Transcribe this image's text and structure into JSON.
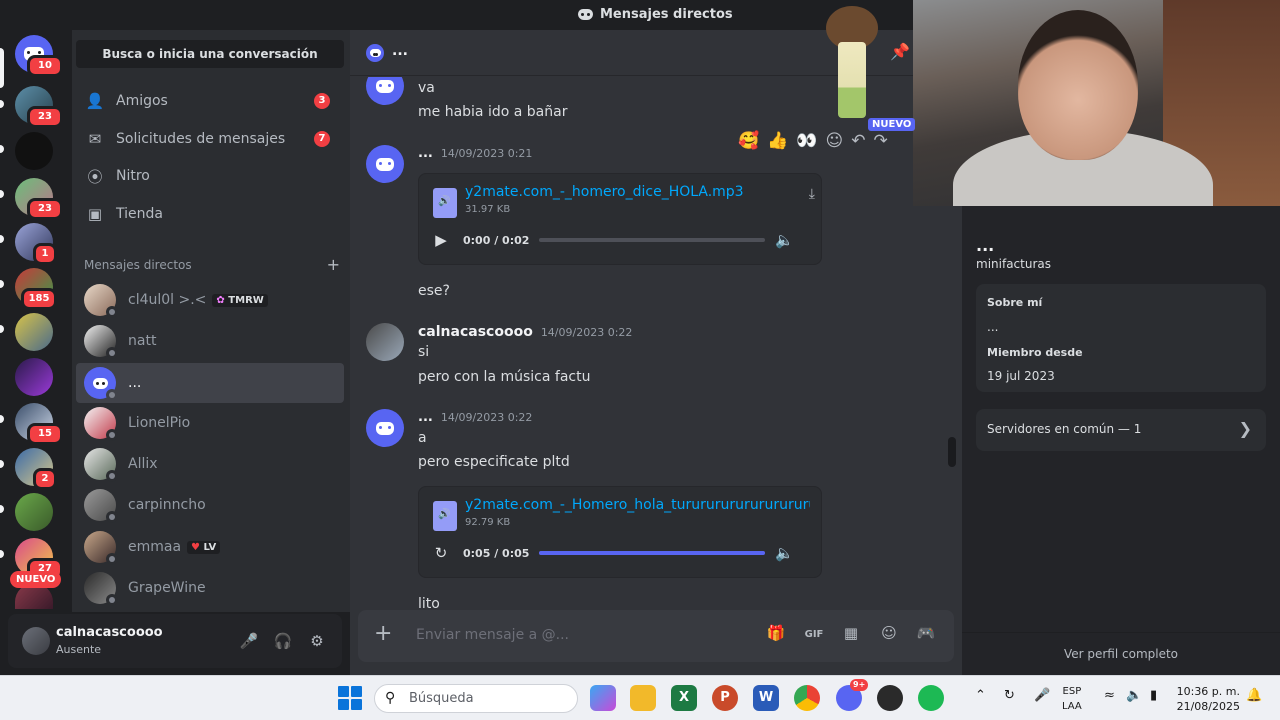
{
  "window": {
    "title": "Mensajes directos"
  },
  "rail": {
    "badges": [
      "10",
      "23",
      "23",
      "1",
      "185",
      "15",
      "2",
      "27"
    ],
    "new_label": "NUEVO"
  },
  "sidebar": {
    "search_placeholder": "Busca o inicia una conversación",
    "nav": [
      {
        "label": "Amigos",
        "count": "3"
      },
      {
        "label": "Solicitudes de mensajes",
        "count": "7"
      },
      {
        "label": "Nitro"
      },
      {
        "label": "Tienda"
      }
    ],
    "dm_header": "Mensajes directos",
    "dms": [
      {
        "name": "cl4ul0l >.<",
        "tag": "TMRW"
      },
      {
        "name": "natt"
      },
      {
        "name": "..."
      },
      {
        "name": "LionelPio"
      },
      {
        "name": "Allix"
      },
      {
        "name": "carpinncho"
      },
      {
        "name": "emmaa",
        "tag": "LV"
      },
      {
        "name": "GrapeWine"
      }
    ]
  },
  "user": {
    "name": "calnacascoooo",
    "status": "Ausente"
  },
  "chat": {
    "header_title": "...",
    "new_tag": "NUEVO",
    "messages": [
      {
        "text1": "va",
        "text2": "me habia ido a bañar"
      },
      {
        "author": "...",
        "time": "14/09/2023 0:21"
      },
      {
        "file_name": "y2mate.com_-_homero_dice_HOLA.mp3",
        "file_size": "31.97 KB",
        "time_display": "0:00 / 0:02",
        "progress": 0
      },
      {
        "text": "ese?"
      },
      {
        "author": "calnacascoooo",
        "time": "14/09/2023 0:22",
        "text1": "si",
        "text2": "pero con la música factu"
      },
      {
        "author": "...",
        "time": "14/09/2023 0:22",
        "text1": "a",
        "text2": "pero especificate pltd"
      },
      {
        "file_name": "y2mate.com_-_Homero_hola_turururururururururu.mp3",
        "file_size": "92.79 KB",
        "time_display": "0:05 / 0:05",
        "progress": 1
      },
      {
        "text": "lito"
      }
    ],
    "composer_placeholder": "Enviar mensaje a @..."
  },
  "profile": {
    "name": "...",
    "username": "minifacturas",
    "about_label": "Sobre mí",
    "about_value": "...",
    "member_label": "Miembro desde",
    "member_value": "19 jul 2023",
    "mutual_label": "Servidores en común — 1",
    "full_profile": "Ver perfil completo"
  },
  "taskbar": {
    "search_placeholder": "Búsqueda",
    "lang1": "ESP",
    "lang2": "LAA",
    "time": "10:36 p. m.",
    "date": "21/08/2025",
    "discord_badge": "9+"
  },
  "colors": {
    "blurple": "#5865f2",
    "danger": "#f23f43",
    "link": "#00a8fc"
  }
}
